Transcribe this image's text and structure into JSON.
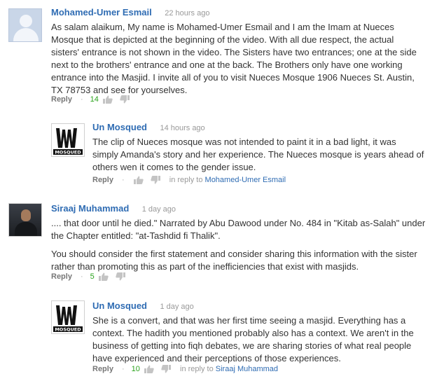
{
  "comments": [
    {
      "author": "Mohamed-Umer Esmail",
      "time": "22 hours ago",
      "lines": [
        "As salam alaikum, My name is Mohamed-Umer Esmail and I am the Imam at Nueces",
        "Mosque that is depicted at the beginning of the video. With all due respect, the actual",
        "sisters' entrance is not shown in the video. The Sisters have two entrances; one at the side",
        "next to the brothers' entrance and one at the back. The Brothers only have one working",
        "entrance into the Masjid. I invite all of you to visit Nueces Mosque 1906 Nueces St. Austin,",
        "TX 78753 and see for yourselves."
      ],
      "reply_label": "Reply",
      "score": "14"
    },
    {
      "author": "Un Mosqued",
      "avatar_label": "MOSQUED",
      "time": "14 hours ago",
      "lines": [
        "The clip of Nueces mosque was not intended to paint it in a bad light, it was",
        "simply Amanda's story and her experience. The Nueces mosque is years ahead of",
        "others wen it comes to the gender issue."
      ],
      "reply_label": "Reply",
      "in_reply_prefix": "in reply to",
      "in_reply_to": "Mohamed-Umer Esmail"
    },
    {
      "author": "Siraaj Muhammad",
      "time": "1 day ago",
      "lines": [
        ".... that door until he died.\" Narrated by Abu Dawood under No. 484 in \"Kitab as-Salah\" under",
        "the Chapter entitled: \"at-Tashdid fi Thalik\"."
      ],
      "lines2": [
        "You should consider the first statement and consider sharing this information with the sister",
        "rather than promoting this as part of the inefficiencies that exist with masjids."
      ],
      "reply_label": "Reply",
      "score": "5"
    },
    {
      "author": "Un Mosqued",
      "avatar_label": "MOSQUED",
      "time": "1 day ago",
      "lines": [
        "She is a convert, and that was her first time seeing a masjid. Everything has a",
        "context. The hadith you mentioned probably also has a context. We aren't in the",
        "business of getting into fiqh debates, we are sharing stories of what real people",
        "have experienced and their perceptions of those experiences."
      ],
      "reply_label": "Reply",
      "score": "10",
      "in_reply_prefix": "in reply to",
      "in_reply_to": "Siraaj Muhammad"
    }
  ],
  "colors": {
    "author_link": "#2f6cb3",
    "score_positive": "#2aa31c",
    "meta_gray": "#999999",
    "text": "#333333"
  },
  "icons": {
    "upvote": "thumbs-up-icon",
    "downvote": "thumbs-down-icon"
  }
}
